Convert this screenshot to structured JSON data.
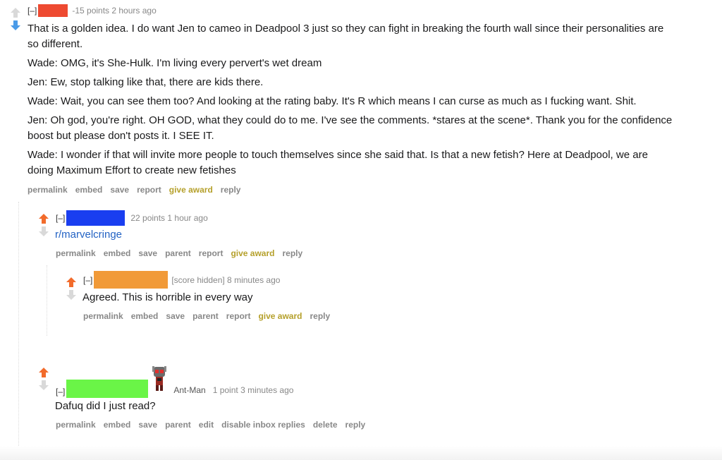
{
  "comments": [
    {
      "expand": "[–]",
      "user_color": "#ee4a31",
      "meta": "-15 points 2 hours ago",
      "paragraphs": [
        "That is a golden idea. I do want Jen to cameo in Deadpool 3 just so they can fight in breaking the fourth wall since their personalities are so different.",
        "Wade: OMG, it's She-Hulk. I'm living every pervert's wet dream",
        "Jen: Ew, stop talking like that, there are kids there.",
        "Wade: Wait, you can see them too? And looking at the rating baby. It's R which means I can curse as much as I fucking want. Shit.",
        "Jen: Oh god, you're right. OH GOD, what they could do to me. I've see the comments. *stares at the scene*. Thank you for the confidence boost but please don't posts it. I SEE IT.",
        "Wade: I wonder if that will invite more people to touch themselves since she said that. Is that a new fetish? Here at Deadpool, we are doing Maximum Effort to create new fetishes"
      ],
      "buttons": [
        "permalink",
        "embed",
        "save",
        "report",
        "give award",
        "reply"
      ]
    },
    {
      "expand": "[–]",
      "user_color": "#1a3ef0",
      "meta": "22 points 1 hour ago",
      "link": "r/marvelcringe",
      "buttons": [
        "permalink",
        "embed",
        "save",
        "parent",
        "report",
        "give award",
        "reply"
      ]
    },
    {
      "expand": "[–]",
      "user_color": "#f19a38",
      "meta": "[score hidden] 8 minutes ago",
      "text": "Agreed. This is horrible in every way",
      "buttons": [
        "permalink",
        "embed",
        "save",
        "parent",
        "report",
        "give award",
        "reply"
      ]
    },
    {
      "expand": "[–]",
      "user_color": "#6af547",
      "flair": "Ant-Man",
      "meta": "1 point 3 minutes ago",
      "text": "Dafuq did I just read?",
      "buttons": [
        "permalink",
        "embed",
        "save",
        "parent",
        "edit",
        "disable inbox replies",
        "delete",
        "reply"
      ]
    }
  ],
  "colors": {
    "upvote": "#f26b2b",
    "downvote": "#4a9be8",
    "neutral_arrow": "#c8c8c8",
    "award": "#b5a02b"
  }
}
